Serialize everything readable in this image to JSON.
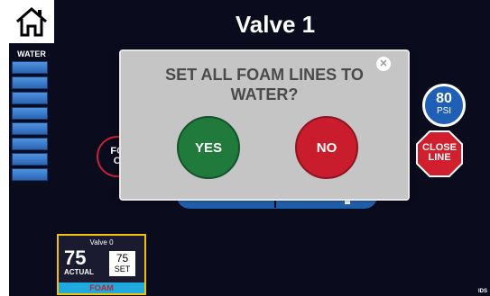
{
  "header": {
    "title": "Valve 1"
  },
  "sidebar": {
    "label": "WATER"
  },
  "background": {
    "foam_circle": {
      "line1": "FO",
      "line2": "O"
    },
    "pressure": {
      "value": "80",
      "unit": "PSI"
    },
    "close_line": {
      "line1": "CLOSE",
      "line2": "LINE"
    }
  },
  "valve_card": {
    "name": "Valve 0",
    "actual_value": "75",
    "actual_label": "ACTUAL",
    "set_value": "75",
    "set_label": "SET",
    "mode": "FOAM"
  },
  "logo": {
    "text": "IDS"
  },
  "dialog": {
    "question": "SET ALL FOAM LINES TO WATER?",
    "yes_label": "YES",
    "no_label": "NO",
    "close_icon": "close-icon"
  },
  "colors": {
    "screen_bg": "#0b0b1e",
    "accent_blue": "#1f5fb5",
    "yes_green": "#1f7a3c",
    "no_red": "#c91c2c",
    "dialog_bg": "#c5c5c5"
  }
}
